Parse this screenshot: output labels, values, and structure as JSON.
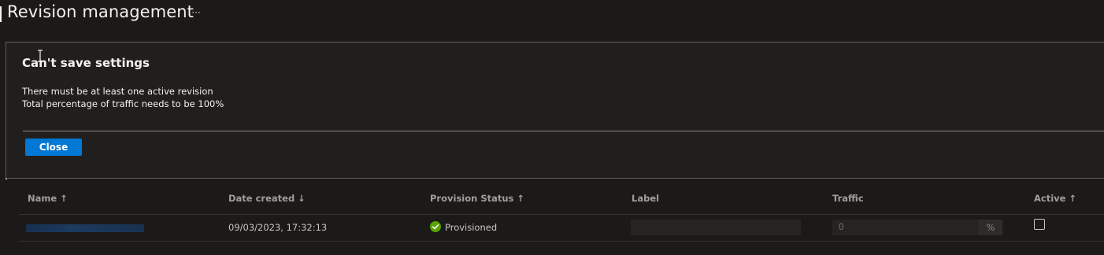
{
  "header": {
    "title": "Revision management",
    "more_label": "···"
  },
  "dialog": {
    "title": "Can't save settings",
    "messages": [
      "There must be at least one active revision",
      "Total percentage of traffic needs to be 100%"
    ],
    "close_label": "Close"
  },
  "table": {
    "columns": [
      {
        "label": "Name ↑"
      },
      {
        "label": "Date created ↓"
      },
      {
        "label": "Provision Status ↑"
      },
      {
        "label": "Label"
      },
      {
        "label": "Traffic"
      },
      {
        "label": "Active ↑"
      }
    ],
    "rows": [
      {
        "date_created": "09/03/2023, 17:32:13",
        "provision_status": "Provisioned",
        "label_value": "",
        "traffic_placeholder": "0",
        "traffic_suffix": "%",
        "active": false
      }
    ]
  },
  "colors": {
    "background": "#1b1a19",
    "accent": "#0078d4",
    "success": "#57a300"
  },
  "icons": {
    "status": "check-circle-icon",
    "cursor": "text-cursor-icon"
  }
}
